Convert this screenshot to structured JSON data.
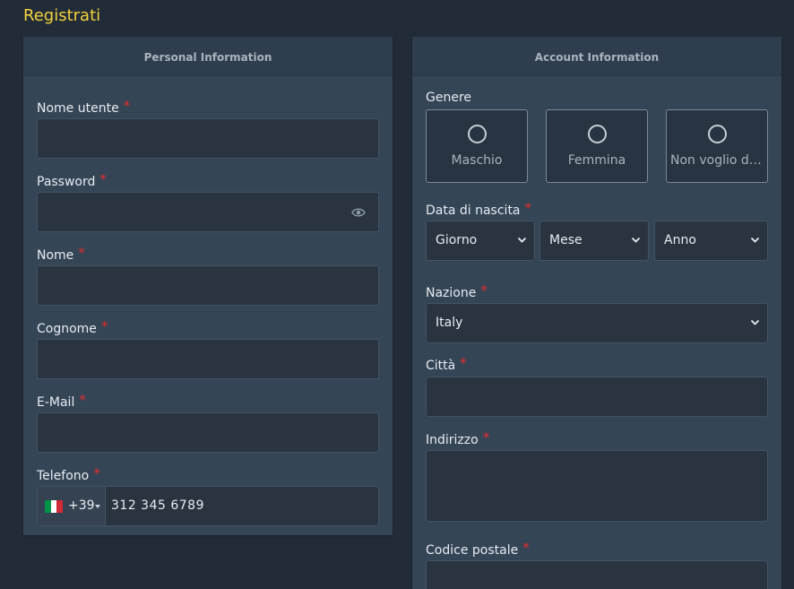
{
  "page": {
    "title": "Registrati"
  },
  "personal": {
    "header": "Personal Information",
    "fields": {
      "username": {
        "label": "Nome utente",
        "value": ""
      },
      "password": {
        "label": "Password",
        "value": ""
      },
      "name": {
        "label": "Nome",
        "value": ""
      },
      "surname": {
        "label": "Cognome",
        "value": ""
      },
      "email": {
        "label": "E-Mail",
        "value": ""
      },
      "phone": {
        "label": "Telefono",
        "prefix": "+39",
        "value": "312 345 6789",
        "flag_colors": [
          "#009246",
          "#ffffff",
          "#ce2b37"
        ]
      }
    },
    "required_mark": "*"
  },
  "account": {
    "header": "Account Information",
    "gender": {
      "label": "Genere",
      "options": [
        "Maschio",
        "Femmina",
        "Non voglio dic..."
      ]
    },
    "birth": {
      "label": "Data di nascita",
      "day": "Giorno",
      "month": "Mese",
      "year": "Anno"
    },
    "country": {
      "label": "Nazione",
      "value": "Italy"
    },
    "city": {
      "label": "Città",
      "value": ""
    },
    "address": {
      "label": "Indirizzo",
      "value": ""
    },
    "postal": {
      "label": "Codice postale",
      "value": ""
    }
  },
  "colors": {
    "accent": "#f4d23a",
    "required": "#e42b2b",
    "card": "#344556",
    "background": "#222b38"
  }
}
